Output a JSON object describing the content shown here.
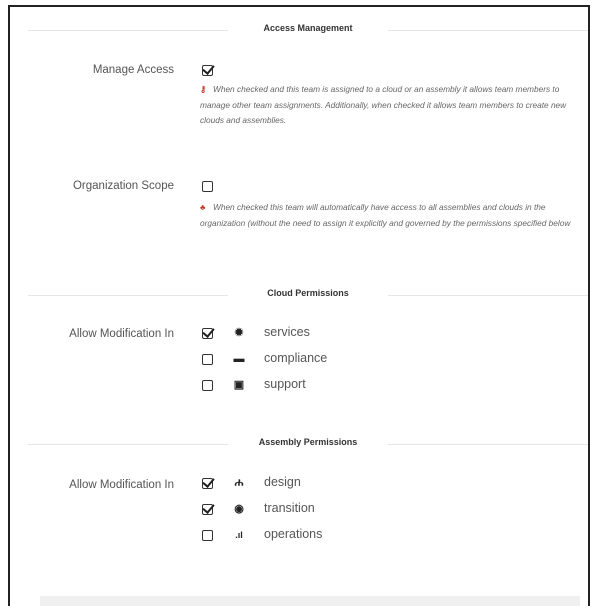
{
  "access": {
    "title": "Access Management",
    "manage_access_label": "Manage Access",
    "manage_access_checked": true,
    "manage_access_help": "When checked and this team is assigned to a cloud or an assembly it allows team members to manage other team assignments. Additionally, when checked it allows team members to create new clouds and assemblies.",
    "org_scope_label": "Organization Scope",
    "org_scope_checked": false,
    "org_scope_help": "When checked this team will automatically have access to all assemblies and clouds in the organization (without the need to assign it explicitly and governed by the permissions specified below"
  },
  "cloud": {
    "title": "Cloud Permissions",
    "row_label": "Allow Modification In",
    "items": [
      {
        "label": "services",
        "icon": "gear-icon",
        "checked": true
      },
      {
        "label": "compliance",
        "icon": "briefcase-icon",
        "checked": false
      },
      {
        "label": "support",
        "icon": "medkit-icon",
        "checked": false
      }
    ]
  },
  "assembly": {
    "title": "Assembly Permissions",
    "row_label": "Allow Modification In",
    "items": [
      {
        "label": "design",
        "icon": "sitemap-icon",
        "checked": true
      },
      {
        "label": "transition",
        "icon": "dot-circle-icon",
        "checked": true
      },
      {
        "label": "operations",
        "icon": "signal-icon",
        "checked": false
      }
    ]
  },
  "colors": {
    "accent_red": "#c0392b",
    "text": "#555555"
  }
}
